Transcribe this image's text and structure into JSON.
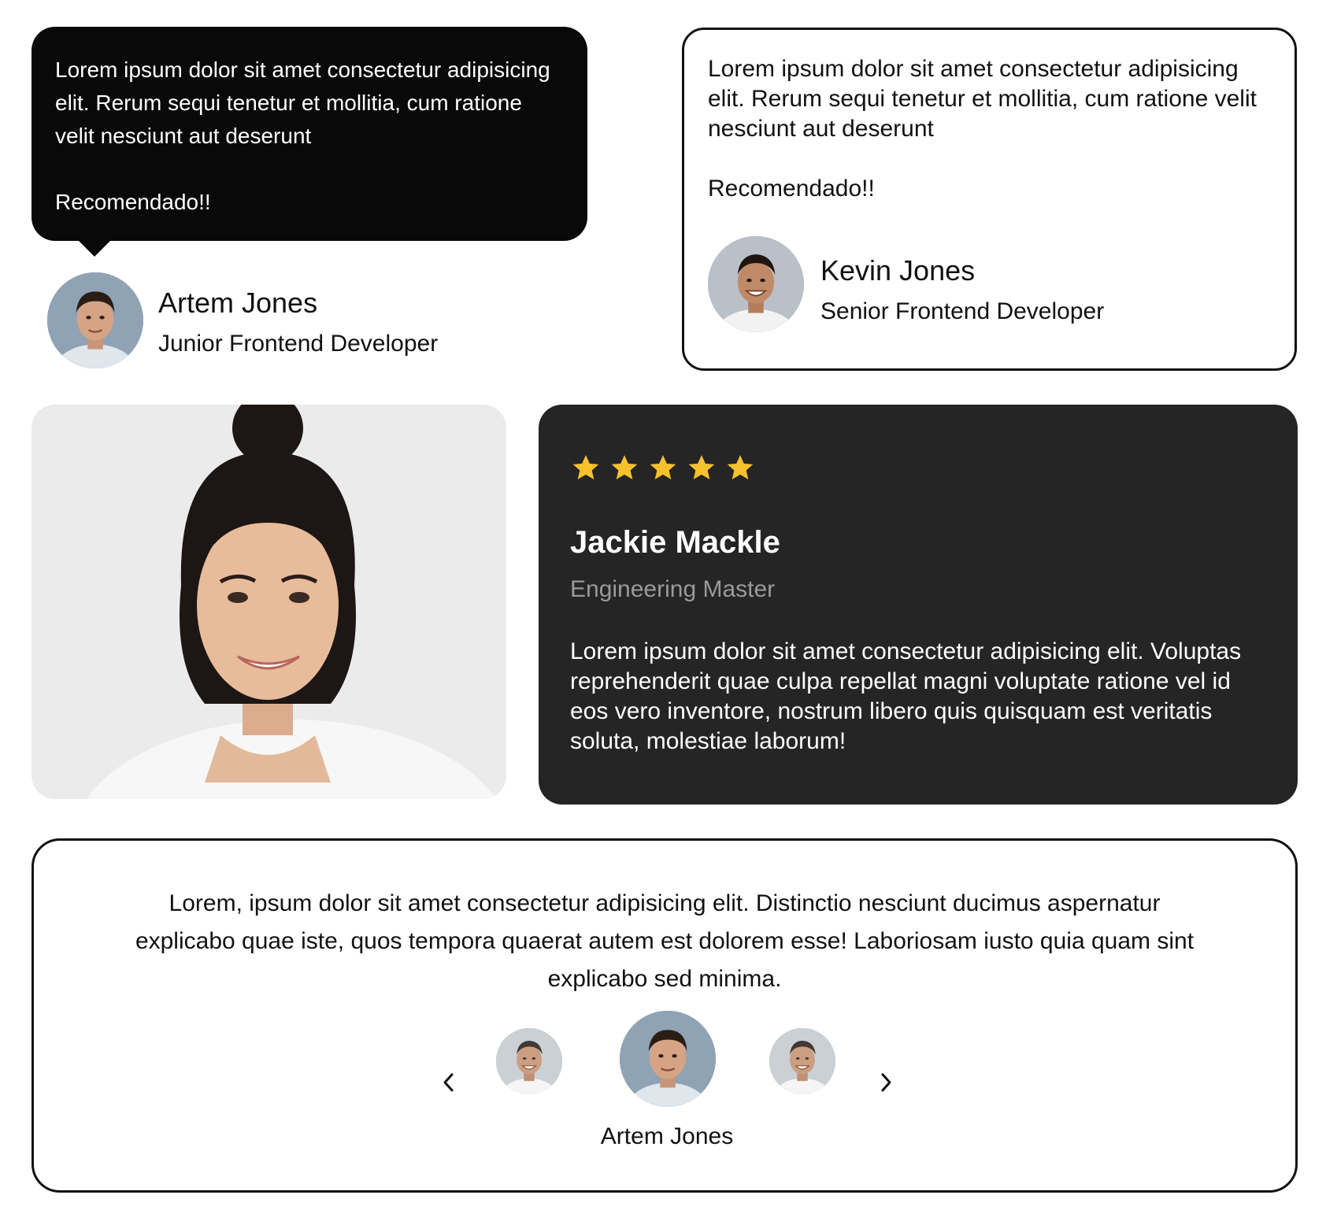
{
  "bubble_card": {
    "quote": "Lorem ipsum dolor sit amet consectetur adipisicing elit. Rerum sequi tenetur et mollitia, cum ratione velit nesciunt aut deserunt",
    "tagline": "Recomendado!!",
    "author_name": "Artem Jones",
    "author_role": "Junior Frontend Developer",
    "avatar_icon": "man-portrait-avatar"
  },
  "outline_card": {
    "quote": "Lorem ipsum dolor sit amet consectetur adipisicing elit. Rerum sequi tenetur et mollitia, cum ratione velit nesciunt aut deserunt",
    "tagline": "Recomendado!!",
    "author_name": "Kevin Jones",
    "author_role": "Senior Frontend Developer",
    "avatar_icon": "smiling-man-avatar"
  },
  "photo_card": {
    "image": "woman-portrait-photo"
  },
  "review_card": {
    "rating": 5,
    "rating_max": 5,
    "star_color": "#F7C12E",
    "name": "Jackie Mackle",
    "role": "Engineering Master",
    "text": "Lorem ipsum dolor sit amet consectetur adipisicing elit. Voluptas reprehenderit quae culpa repellat magni voluptate ratione vel id eos vero inventore, nostrum libero quis quisquam est veritatis soluta, molestiae laborum!",
    "background": "#252525"
  },
  "carousel_card": {
    "text": "Lorem, ipsum dolor sit amet consectetur adipisicing elit. Distinctio nesciunt ducimus aspernatur explicabo quae iste, quos tempora quaerat autem est dolorem esse! Laboriosam iusto quia quam sint explicabo sed minima.",
    "active_name": "Artem Jones",
    "prev_icon": "chevron-left-icon",
    "next_icon": "chevron-right-icon"
  }
}
